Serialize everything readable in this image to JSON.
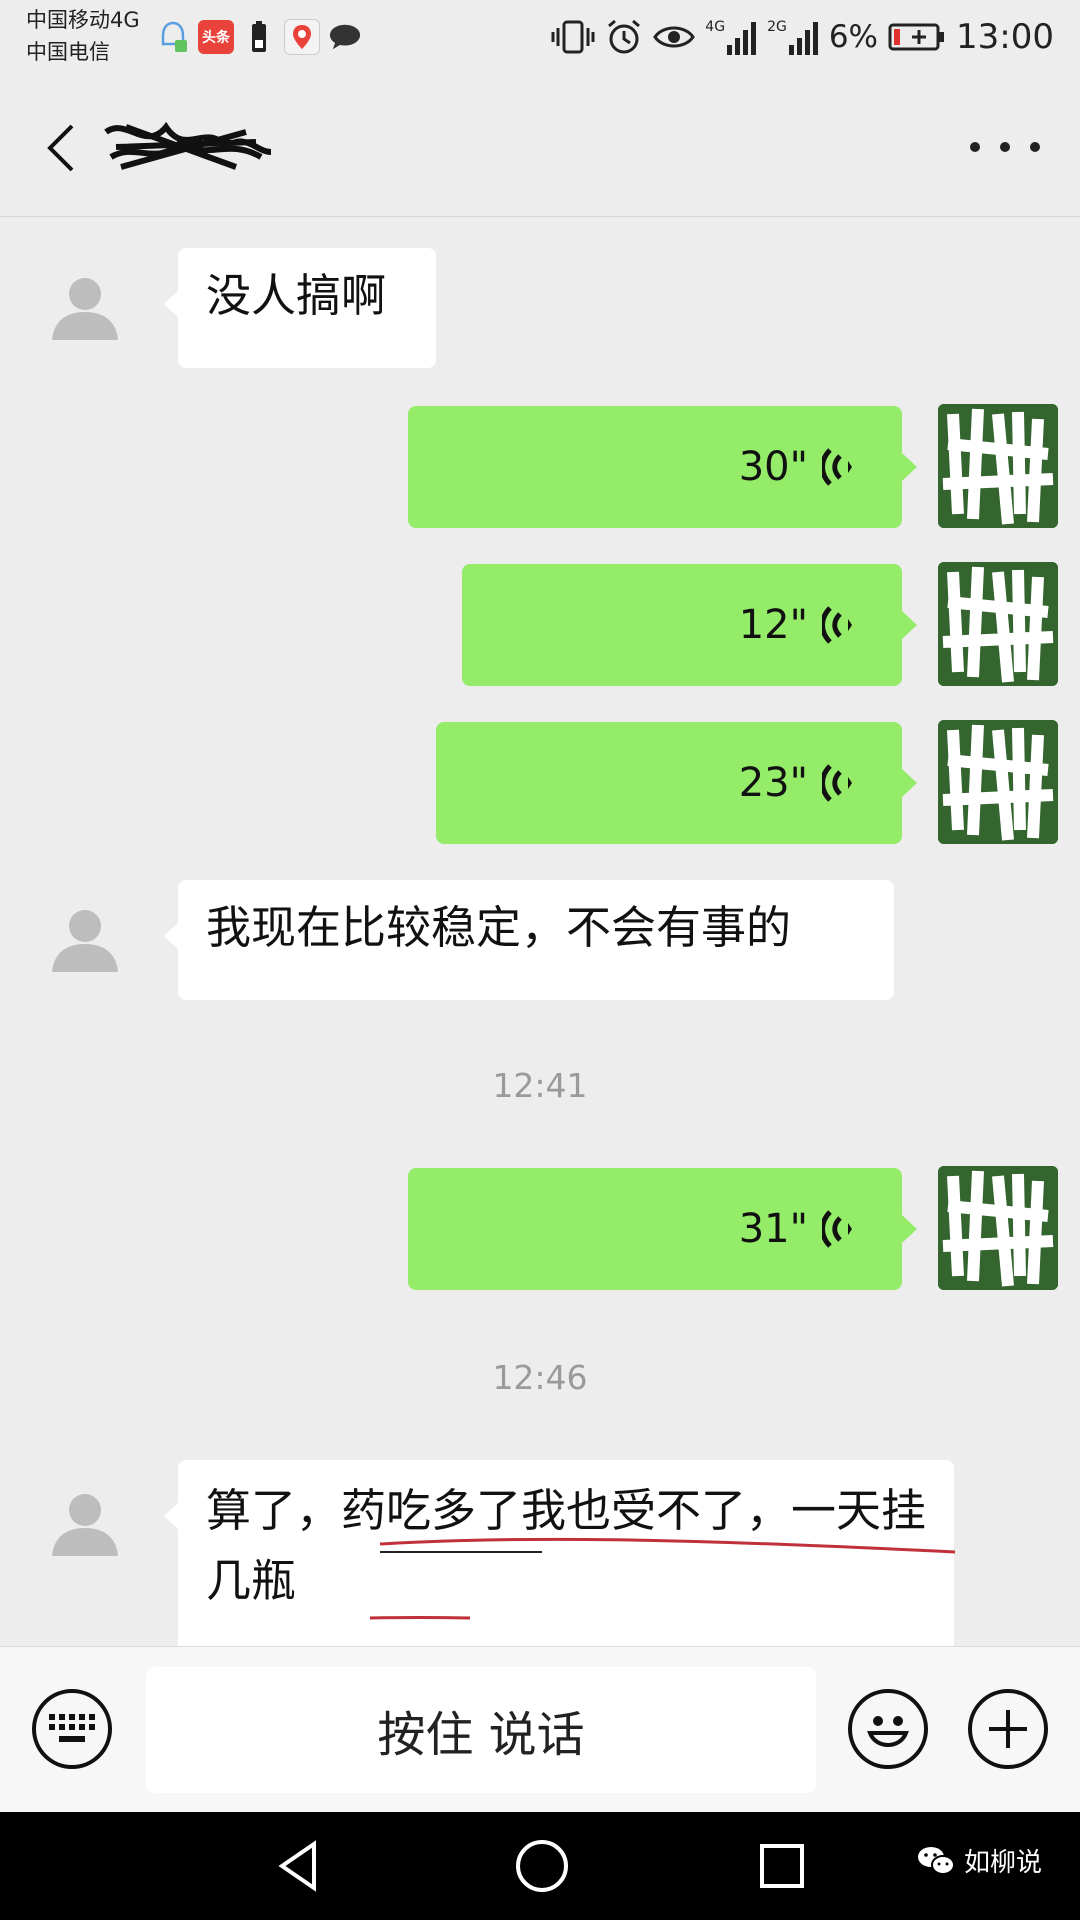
{
  "status_bar": {
    "carrier_1": "中国移动4G",
    "carrier_2": "中国电信",
    "notif_toutiao": "头条",
    "net_4g": "4G",
    "net_2g": "2G",
    "battery": "6%",
    "time": "13:00",
    "battery_color": "#e03030"
  },
  "header": {
    "back_icon": "chevron-left-icon",
    "more_icon": "more-dots-icon"
  },
  "messages": [
    {
      "side": "in",
      "type": "text",
      "text": "没人搞啊"
    },
    {
      "side": "out",
      "type": "voice",
      "duration": "30\""
    },
    {
      "side": "out",
      "type": "voice",
      "duration": "12\""
    },
    {
      "side": "out",
      "type": "voice",
      "duration": "23\""
    },
    {
      "side": "in",
      "type": "text",
      "text": "我现在比较稳定，不会有事的"
    },
    {
      "type": "time",
      "text": "12:41"
    },
    {
      "side": "out",
      "type": "voice",
      "duration": "31\""
    },
    {
      "type": "time",
      "text": "12:46"
    },
    {
      "side": "in",
      "type": "text",
      "text": "算了，药吃多了我也受不了，一天挂几瓶"
    }
  ],
  "input_bar": {
    "keyboard_icon": "keyboard-icon",
    "hold_to_talk": "按住 说话",
    "emoji_icon": "emoji-icon",
    "plus_icon": "plus-icon"
  },
  "nav_bar": {
    "watermark": "如柳说"
  },
  "colors": {
    "bg": "#ededed",
    "outgoing_bubble": "#95ec69",
    "incoming_bubble": "#ffffff",
    "underline": "#c0303a"
  }
}
